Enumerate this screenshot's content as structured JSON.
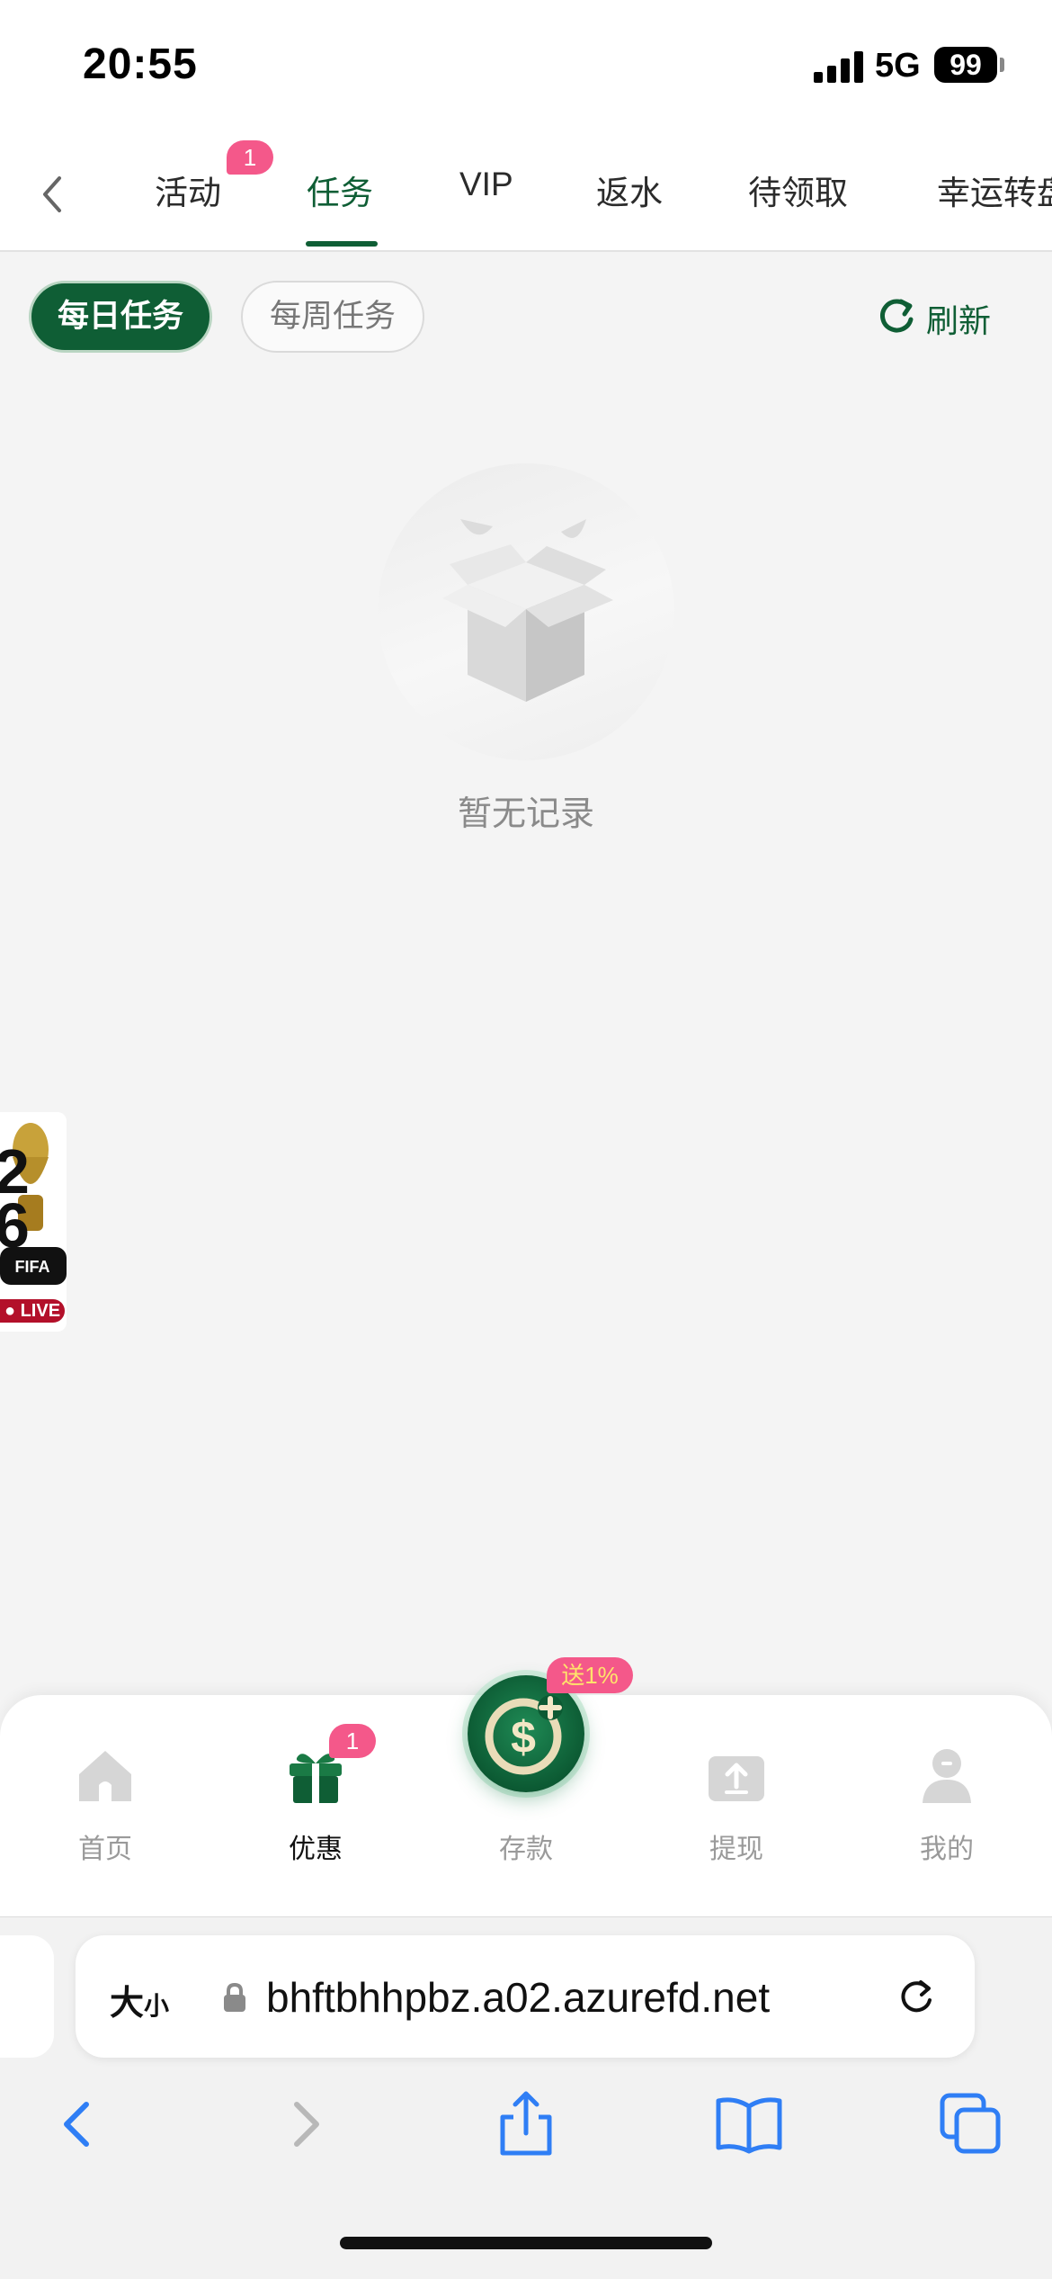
{
  "status_bar": {
    "time": "20:55",
    "network": "5G",
    "battery": "99"
  },
  "tabs": {
    "items": [
      {
        "label": "活动",
        "badge": "1"
      },
      {
        "label": "任务",
        "active": true
      },
      {
        "label": "VIP"
      },
      {
        "label": "返水"
      },
      {
        "label": "待领取"
      },
      {
        "label": "幸运转盘"
      }
    ]
  },
  "filters": {
    "daily": "每日任务",
    "weekly": "每周任务",
    "refresh": "刷新"
  },
  "empty_state": {
    "text": "暂无记录"
  },
  "widget": {
    "brand": "FIFA",
    "live": "LIVE"
  },
  "bottom_nav": {
    "items": [
      {
        "label": "首页",
        "icon": "home-icon"
      },
      {
        "label": "优惠",
        "icon": "gift-icon",
        "badge": "1",
        "active": true
      },
      {
        "label": "存款",
        "icon": "deposit-icon",
        "promo": "送1%"
      },
      {
        "label": "提现",
        "icon": "withdraw-icon"
      },
      {
        "label": "我的",
        "icon": "profile-icon"
      }
    ]
  },
  "browser": {
    "aa_big": "大",
    "aa_small": "小",
    "url": "bhftbhhpbz.a02.azurefd.net"
  },
  "colors": {
    "accent": "#0f5e35",
    "badge": "#f4588a"
  }
}
